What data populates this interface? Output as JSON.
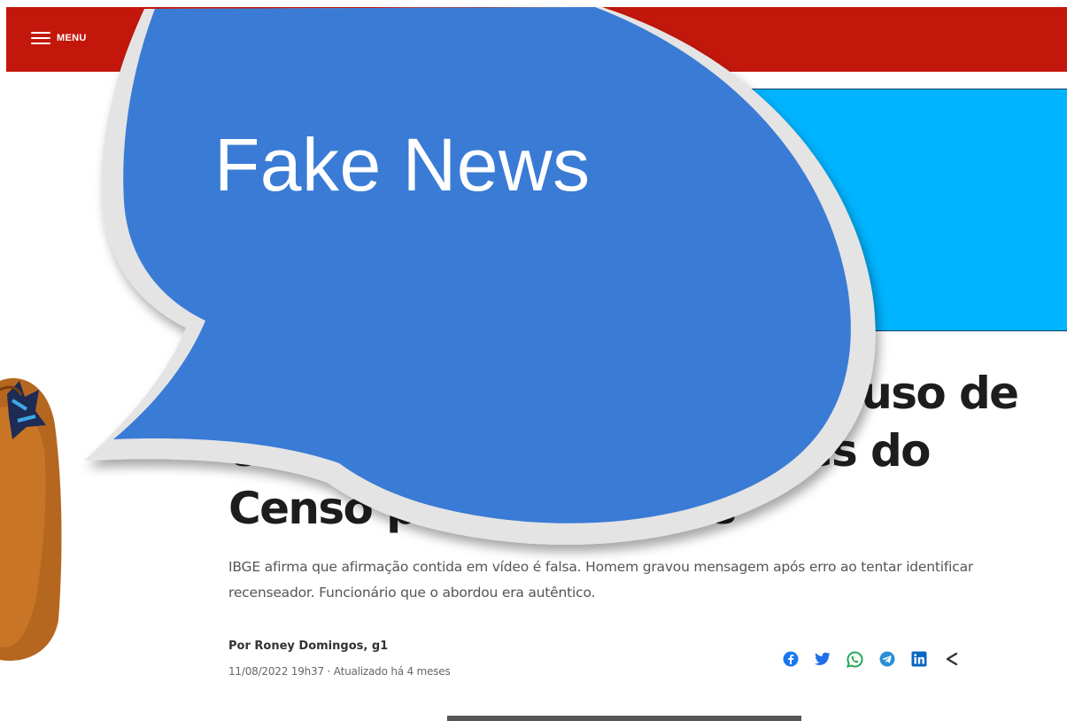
{
  "header": {
    "menu_label": "MENU",
    "color": "#c4170c"
  },
  "ad": {
    "color": "#00b4ff"
  },
  "article": {
    "headline": "É #FAKE mensagem sobre uso de coletes amarelos e coletes do Censo por criminosos",
    "subtitle": "IBGE afirma que afirmação contida em vídeo é falsa. Homem gravou mensagem após erro ao tentar identificar recenseador. Funcionário que o abordou era autêntico.",
    "byline": "Por Roney Domingos, g1",
    "timestamp": "11/08/2022 19h37 · Atualizado há 4 meses"
  },
  "share": {
    "icons": [
      "facebook-icon",
      "twitter-icon",
      "whatsapp-icon",
      "telegram-icon",
      "linkedin-icon",
      "share-icon"
    ],
    "color": "#3366cc"
  },
  "overlay": {
    "label": "Fake News",
    "color": "#3a7bd5"
  }
}
